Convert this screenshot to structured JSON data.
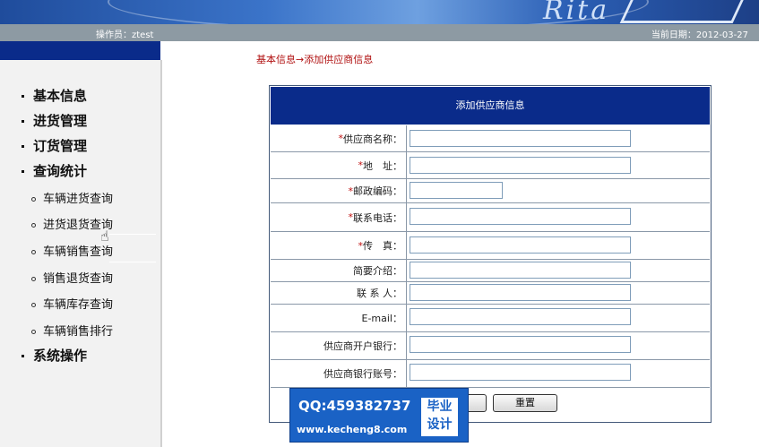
{
  "header": {
    "logo_text": "Rita",
    "operator": "操作员：ztest",
    "date": "当前日期：2012-03-27"
  },
  "sidebar": {
    "menu": [
      "基本信息",
      "进货管理",
      "订货管理",
      "查询统计"
    ],
    "submenu": [
      "车辆进货查询",
      "进货退货查询",
      "车辆销售查询",
      "销售退货查询",
      "车辆库存查询",
      "车辆销售排行"
    ],
    "last_menu": "系统操作"
  },
  "breadcrumb": "基本信息→添加供应商信息",
  "form": {
    "title": "添加供应商信息",
    "fields": [
      {
        "star": "*",
        "label": "供应商名称：",
        "value": ""
      },
      {
        "star": "*",
        "label": "地　址：",
        "value": ""
      },
      {
        "star": "*",
        "label": "邮政编码：",
        "value": ""
      },
      {
        "star": "*",
        "label": "联系电话：",
        "value": ""
      },
      {
        "star": "*",
        "label": "传　真：",
        "value": ""
      },
      {
        "star": "",
        "label": "简要介绍：",
        "value": ""
      },
      {
        "star": "",
        "label": "联 系 人：",
        "value": ""
      },
      {
        "star": "",
        "label": "E-mail：",
        "value": ""
      },
      {
        "star": "",
        "label": "供应商开户银行：",
        "value": ""
      },
      {
        "star": "",
        "label": "供应商银行账号：",
        "value": ""
      }
    ],
    "reset_label": "重置"
  },
  "watermark": {
    "qq": "QQ:459382737",
    "url": "www.kecheng8.com",
    "badge_line1": "毕业",
    "badge_line2": "设计"
  }
}
